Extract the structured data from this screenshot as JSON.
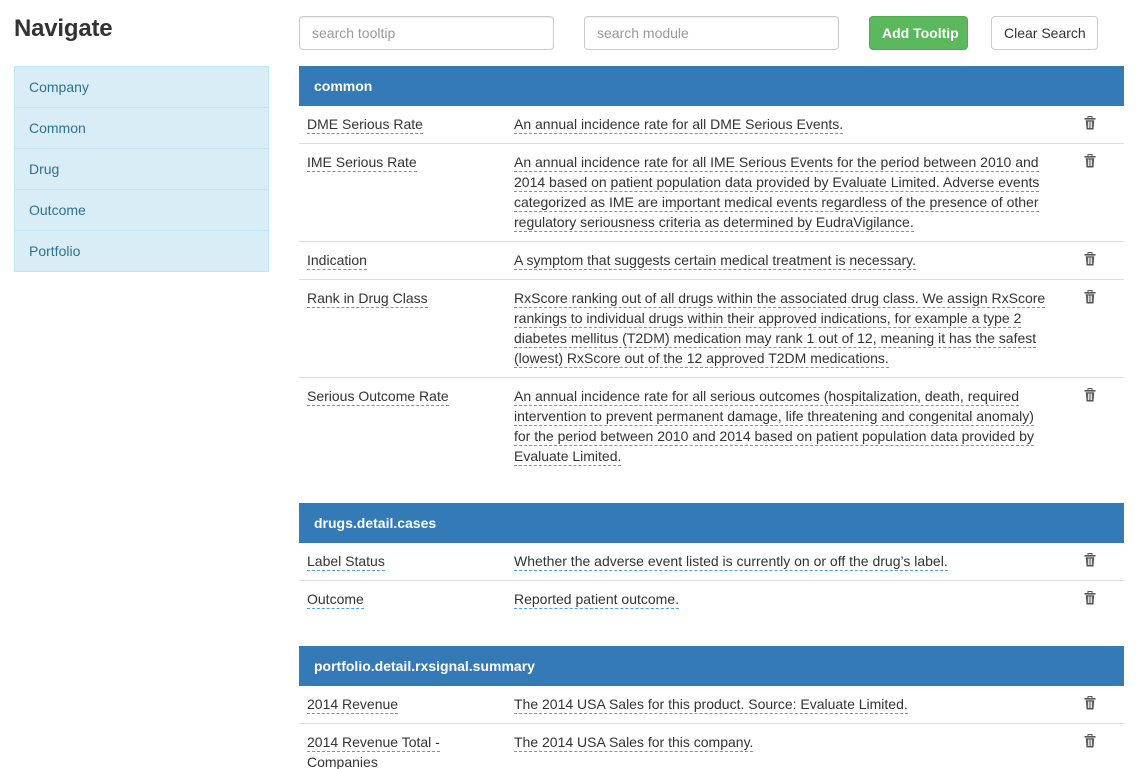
{
  "sidebar": {
    "title": "Navigate",
    "items": [
      {
        "label": "Company"
      },
      {
        "label": "Common"
      },
      {
        "label": "Drug"
      },
      {
        "label": "Outcome"
      },
      {
        "label": "Portfolio"
      }
    ]
  },
  "toolbar": {
    "search_tooltip_placeholder": "search tooltip",
    "search_module_placeholder": "search module",
    "add_label": "Add Tooltip",
    "clear_label": "Clear Search"
  },
  "colors": {
    "header": "#337ab7",
    "success": "#5cb85c",
    "nav_bg": "#d9edf7",
    "nav_text": "#31708f"
  },
  "delete_icon": "trash-icon",
  "modules": [
    {
      "name": "common",
      "rows": [
        {
          "key": "DME Serious Rate",
          "desc": "An annual incidence rate for all DME Serious Events."
        },
        {
          "key": "IME Serious Rate",
          "desc": "An annual incidence rate for all IME Serious Events for the period between 2010 and 2014 based on patient population data provided by Evaluate Limited. Adverse events categorized as IME are important medical events regardless of the presence of other regulatory seriousness criteria as determined by EudraVigilance."
        },
        {
          "key": "Indication",
          "desc": "A symptom that suggests certain medical treatment is necessary."
        },
        {
          "key": "Rank in Drug Class",
          "desc": "RxScore ranking out of all drugs within the associated drug class. We assign RxScore rankings to individual drugs within their approved indications, for example a type 2 diabetes mellitus (T2DM) medication may rank 1 out of 12, meaning it has the safest (lowest) RxScore out of the 12 approved T2DM medications."
        },
        {
          "key": "Serious Outcome Rate",
          "desc": "An annual incidence rate for all serious outcomes (hospitalization, death, required intervention to prevent permanent damage, life threatening and congenital anomaly) for the period between 2010 and 2014 based on patient population data provided by Evaluate Limited."
        }
      ]
    },
    {
      "name": "drugs.detail.cases",
      "rows": [
        {
          "key": "Label Status",
          "desc": "Whether the adverse event listed is currently on or off the drug’s label."
        },
        {
          "key": "Outcome",
          "desc": "Reported patient outcome."
        }
      ]
    },
    {
      "name": "portfolio.detail.rxsignal.summary",
      "rows": [
        {
          "key": "2014 Revenue",
          "desc": "The 2014 USA Sales for this product. Source: Evaluate Limited."
        },
        {
          "key": "2014 Revenue Total - Companies",
          "desc": "The 2014 USA Sales for this company."
        }
      ]
    }
  ]
}
